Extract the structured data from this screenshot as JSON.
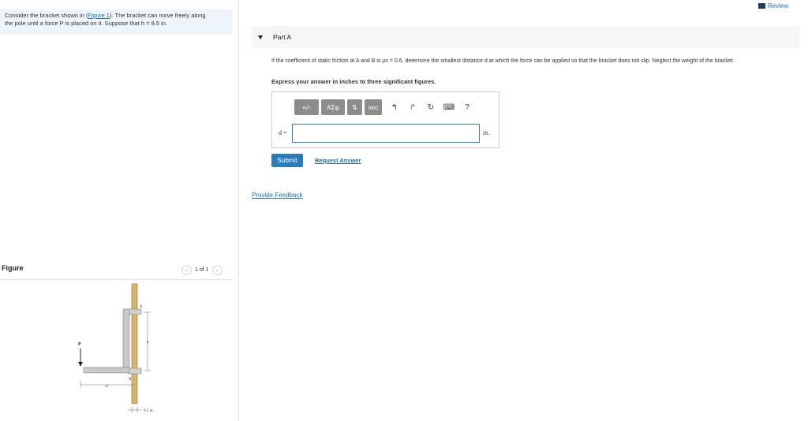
{
  "problem": {
    "intro": "Consider the bracket shown in (",
    "figure_link": "Figure 1",
    "intro_rest": "). The bracket can move freely along",
    "line2": "the pole until a force P is placed on it. Suppose that h = 8.5 in."
  },
  "header": {
    "review": "Review"
  },
  "figure": {
    "title": "Figure",
    "pager": "1 of 1",
    "labels": {
      "A": "A",
      "B": "B",
      "P": "P",
      "h": "h",
      "d": "d",
      "thickness": "0.5 in."
    }
  },
  "part": {
    "title": "Part A"
  },
  "question": {
    "text": "If the coefficient of static friction at A and B is μs = 0.6, determine the smallest distance d at which the force can be applied so that the bracket does not slip. Neglect the weight of the bracket.",
    "instruction": "Express your answer in inches to three significant figures."
  },
  "toolbar": {
    "templates": "▪√▫",
    "greek": "ΑΣφ",
    "arrows": "⇅",
    "vec": "vec",
    "undo": "↰",
    "redo": "↱",
    "reset": "↻",
    "keyboard": "⌨",
    "help": "?"
  },
  "answer": {
    "label": "d =",
    "value": "",
    "unit": "in."
  },
  "buttons": {
    "submit": "Submit",
    "request": "Request Answer"
  },
  "feedback": "Provide Feedback"
}
